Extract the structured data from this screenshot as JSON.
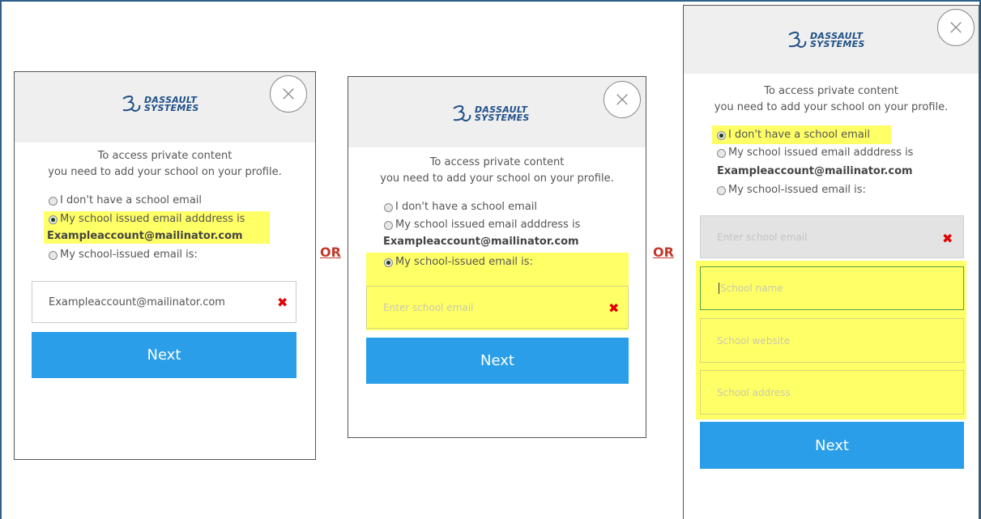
{
  "brand": {
    "line1": "DASSAULT",
    "line2": "SYSTEMES"
  },
  "close_glyph": "×",
  "separator": "OR",
  "intro": {
    "line1": "To access private content",
    "line2": "you need to add your school on your profile."
  },
  "options": {
    "no_email": "I don't have a school email",
    "issued": "My school issued email adddress is",
    "issued_email": "Exampleaccount@mailinator.com",
    "manual": "My school-issued email is:"
  },
  "panel1": {
    "email_value": "Exampleaccount@mailinator.com",
    "next_label": "Next",
    "selected": "issued"
  },
  "panel2": {
    "email_placeholder": "Enter school email",
    "next_label": "Next",
    "selected": "manual"
  },
  "panel3": {
    "email_placeholder": "Enter school email",
    "school_name_placeholder": "School name",
    "school_website_placeholder": "School website",
    "school_address_placeholder": "School address",
    "next_label": "Next",
    "selected": "no_email"
  },
  "colors": {
    "accent": "#2a9ee8",
    "highlight": "#ffff66",
    "error": "#e00000",
    "separator": "#c0392b",
    "brand": "#1f4f86"
  },
  "icons": [
    "dassault-logo-icon",
    "close-icon",
    "clear-x-icon",
    "radio-icon"
  ]
}
